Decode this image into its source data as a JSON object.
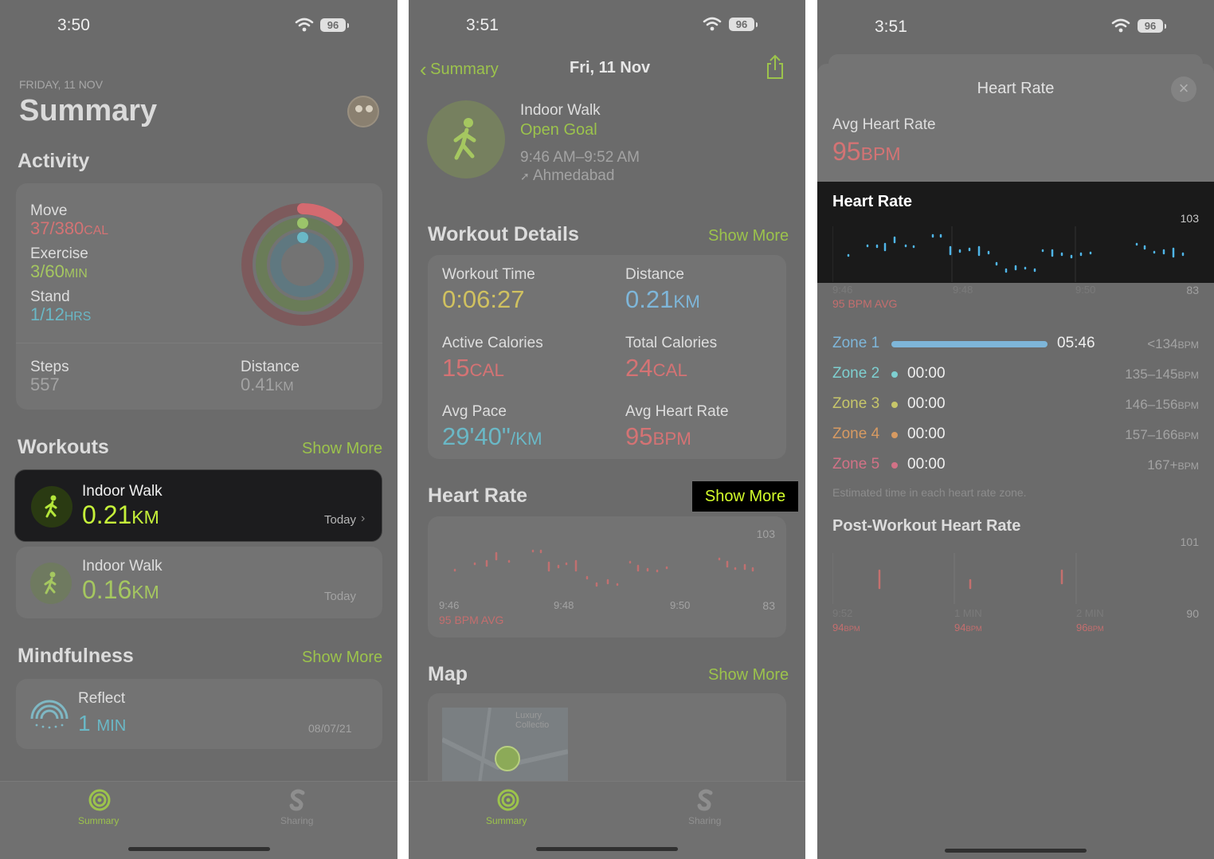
{
  "panel1": {
    "status": {
      "time": "3:50",
      "battery": "96"
    },
    "date": "FRIDAY, 11 NOV",
    "title": "Summary",
    "activity": {
      "title": "Activity",
      "move_label": "Move",
      "move_value": "37/380",
      "move_unit": "CAL",
      "exercise_label": "Exercise",
      "exercise_value": "3/60",
      "exercise_unit": "MIN",
      "stand_label": "Stand",
      "stand_value": "1/12",
      "stand_unit": "HRS",
      "steps_label": "Steps",
      "steps_value": "557",
      "distance_label": "Distance",
      "distance_value": "0.41",
      "distance_unit": "KM"
    },
    "workouts": {
      "title": "Workouts",
      "show_more": "Show More",
      "items": [
        {
          "name": "Indoor Walk",
          "value": "0.21",
          "unit": "KM",
          "date": "Today"
        },
        {
          "name": "Indoor Walk",
          "value": "0.16",
          "unit": "KM",
          "date": "Today"
        }
      ]
    },
    "mindfulness": {
      "title": "Mindfulness",
      "show_more": "Show More",
      "item": {
        "name": "Reflect",
        "value": "1",
        "unit": "MIN",
        "date": "08/07/21"
      }
    },
    "tabs": [
      "Summary",
      "Sharing"
    ]
  },
  "panel2": {
    "status": {
      "time": "3:51",
      "battery": "96"
    },
    "back_label": "Summary",
    "nav_title": "Fri, 11 Nov",
    "workout": {
      "name": "Indoor Walk",
      "goal": "Open Goal",
      "time_range": "9:46 AM–9:52 AM",
      "location": "Ahmedabad"
    },
    "details": {
      "title": "Workout Details",
      "show_more": "Show More",
      "workout_time_label": "Workout Time",
      "workout_time_value": "0:06:27",
      "distance_label": "Distance",
      "distance_value": "0.21",
      "distance_unit": "KM",
      "active_cal_label": "Active Calories",
      "active_cal_value": "15",
      "active_cal_unit": "CAL",
      "total_cal_label": "Total Calories",
      "total_cal_value": "24",
      "total_cal_unit": "CAL",
      "avg_pace_label": "Avg Pace",
      "avg_pace_value": "29'40\"",
      "avg_pace_unit": "/KM",
      "avg_hr_label": "Avg Heart Rate",
      "avg_hr_value": "95",
      "avg_hr_unit": "BPM"
    },
    "heart_rate": {
      "title": "Heart Rate",
      "show_more": "Show More",
      "ymax": "103",
      "ymin": "83",
      "x_ticks": [
        "9:46",
        "9:48",
        "9:50"
      ],
      "avg": "95 BPM AVG"
    },
    "map": {
      "title": "Map",
      "show_more": "Show More",
      "poi": "Luxury Collectio"
    },
    "tabs": [
      "Summary",
      "Sharing"
    ]
  },
  "panel3": {
    "status": {
      "time": "3:51",
      "battery": "96"
    },
    "sheet_title": "Heart Rate",
    "avg_label": "Avg Heart Rate",
    "avg_value": "95",
    "avg_unit": "BPM",
    "chart_title": "Heart Rate",
    "ymax": "103",
    "ymin": "83",
    "x_ticks": [
      "9:46",
      "9:48",
      "9:50"
    ],
    "avg": "95 BPM AVG",
    "zones": [
      {
        "name": "Zone 1",
        "time": "05:46",
        "range": "<134",
        "unit": "BPM",
        "color": "#7eb6d9"
      },
      {
        "name": "Zone 2",
        "time": "00:00",
        "range": "135–145",
        "unit": "BPM",
        "color": "#7ecfd0"
      },
      {
        "name": "Zone 3",
        "time": "00:00",
        "range": "146–156",
        "unit": "BPM",
        "color": "#c7c66a"
      },
      {
        "name": "Zone 4",
        "time": "00:00",
        "range": "157–166",
        "unit": "BPM",
        "color": "#d79a62"
      },
      {
        "name": "Zone 5",
        "time": "00:00",
        "range": "167+",
        "unit": "BPM",
        "color": "#d27286"
      }
    ],
    "zone_note": "Estimated time in each heart rate zone.",
    "post": {
      "title": "Post-Workout Heart Rate",
      "ymax": "101",
      "ymin": "90",
      "x_ticks": [
        "9:52",
        "1 MIN",
        "2 MIN"
      ],
      "values": [
        {
          "value": "94",
          "unit": "BPM"
        },
        {
          "value": "94",
          "unit": "BPM"
        },
        {
          "value": "96",
          "unit": "BPM"
        }
      ]
    }
  },
  "colors": {
    "background": "#6b6b6b",
    "accent_green": "#9cc34c",
    "highlight_lime": "#d4ff2b",
    "heart_red": "#d47374",
    "zone_blue": "#7eb6d9"
  },
  "icons": [
    "wifi-icon",
    "battery-icon",
    "avatar",
    "activity-rings",
    "walk-icon",
    "mindfulness-icon",
    "summary-tab-icon",
    "sharing-tab-icon",
    "chevron-left-icon",
    "share-icon",
    "location-arrow-icon",
    "close-icon",
    "map-pin-icon"
  ]
}
